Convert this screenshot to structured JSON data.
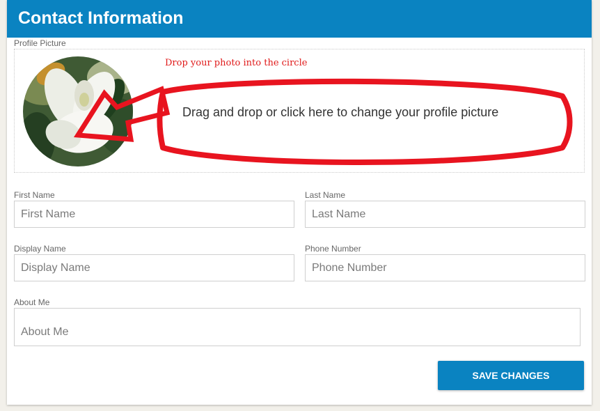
{
  "header": {
    "title": "Contact Information"
  },
  "profile_picture": {
    "label": "Profile Picture",
    "annotation": "Drop your photo into the circle",
    "drop_text": "Drag and drop or click here to change your profile picture",
    "avatar_icon": "magnolia-flower-photo"
  },
  "form": {
    "first_name": {
      "label": "First Name",
      "placeholder": "First Name",
      "value": ""
    },
    "last_name": {
      "label": "Last Name",
      "placeholder": "Last Name",
      "value": ""
    },
    "display_name": {
      "label": "Display Name",
      "placeholder": "Display Name",
      "value": ""
    },
    "phone_number": {
      "label": "Phone Number",
      "placeholder": "Phone Number",
      "value": ""
    },
    "about_me": {
      "label": "About Me",
      "placeholder": "About Me",
      "value": ""
    }
  },
  "actions": {
    "save_label": "SAVE CHANGES"
  },
  "colors": {
    "brand_blue": "#0a83c1",
    "annotation_red": "#e8141f",
    "page_background": "#f2f0ea"
  }
}
